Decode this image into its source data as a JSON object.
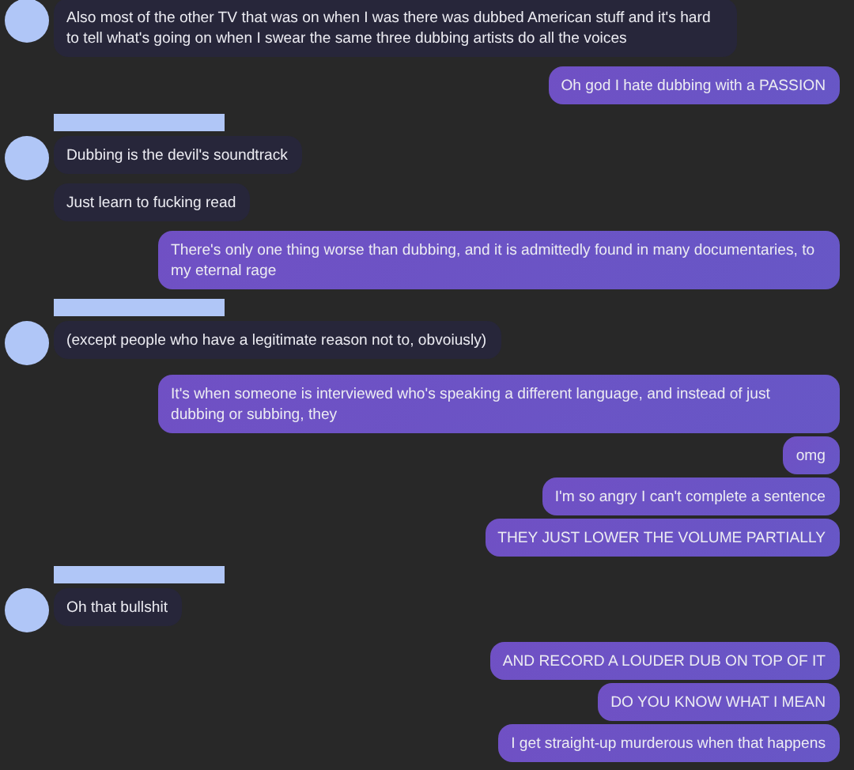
{
  "groups": [
    {
      "kind": "received",
      "name_redacted": false,
      "messages": [
        "Also most of the other TV that was on when I was there was dubbed American stuff and it's hard to tell what's going on when I swear the same three dubbing artists do all the voices"
      ]
    },
    {
      "kind": "sent",
      "messages": [
        "Oh god I hate dubbing with a PASSION"
      ]
    },
    {
      "kind": "received",
      "name_redacted": true,
      "messages": [
        "Dubbing is the devil's soundtrack",
        "Just learn to fucking read"
      ]
    },
    {
      "kind": "sent",
      "messages": [
        "There's only one thing worse than dubbing, and it is admittedly found in many documentaries, to my eternal rage"
      ]
    },
    {
      "kind": "received",
      "name_redacted": true,
      "messages": [
        "(except people who have a legitimate reason not to, obvoiusly)"
      ]
    },
    {
      "kind": "sent",
      "messages": [
        "It's when someone is interviewed who's speaking a different language, and instead of just dubbing or subbing, they",
        "omg",
        "I'm so angry I can't complete a sentence",
        "THEY JUST LOWER THE VOLUME PARTIALLY"
      ]
    },
    {
      "kind": "received",
      "name_redacted": true,
      "messages": [
        "Oh that bullshit"
      ]
    },
    {
      "kind": "sent",
      "messages": [
        "AND RECORD A LOUDER DUB ON TOP OF IT",
        "DO YOU KNOW WHAT I MEAN",
        "I get straight-up murderous when that happens"
      ]
    }
  ]
}
